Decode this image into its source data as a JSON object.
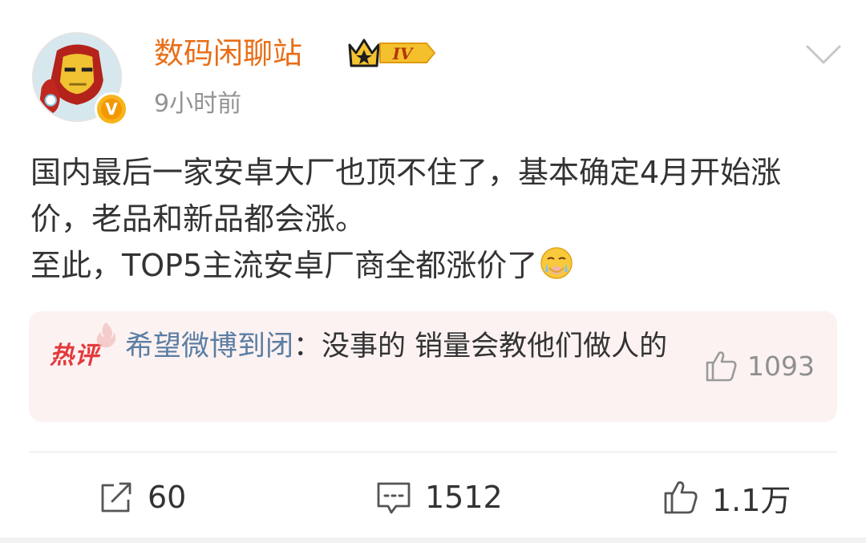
{
  "post": {
    "author": {
      "name": "数码闲聊站",
      "level_badge": "IV",
      "verified_mark": "V",
      "timestamp": "9小时前",
      "avatar_icon": "iron-man-avatar"
    },
    "content": {
      "paragraph1": "国内最后一家安卓大厂也顶不住了，基本确定4月开始涨价，老品和新品都会涨。",
      "paragraph2": "至此，TOP5主流安卓厂商全都涨价了",
      "emoji": "crying-face-emoji"
    },
    "hot_comment": {
      "label": "热评",
      "author": "希望微博到闭",
      "separator": "：",
      "text": "没事的 销量会教他们做人的",
      "like_count": "1093"
    },
    "actions": {
      "repost_count": "60",
      "comment_count": "1512",
      "like_count": "1.1万"
    },
    "colors": {
      "username": "#e86e17",
      "comment_author": "#5b7ea3",
      "hot_label": "#e4393c",
      "hot_bg": "#fcf2f2"
    }
  }
}
